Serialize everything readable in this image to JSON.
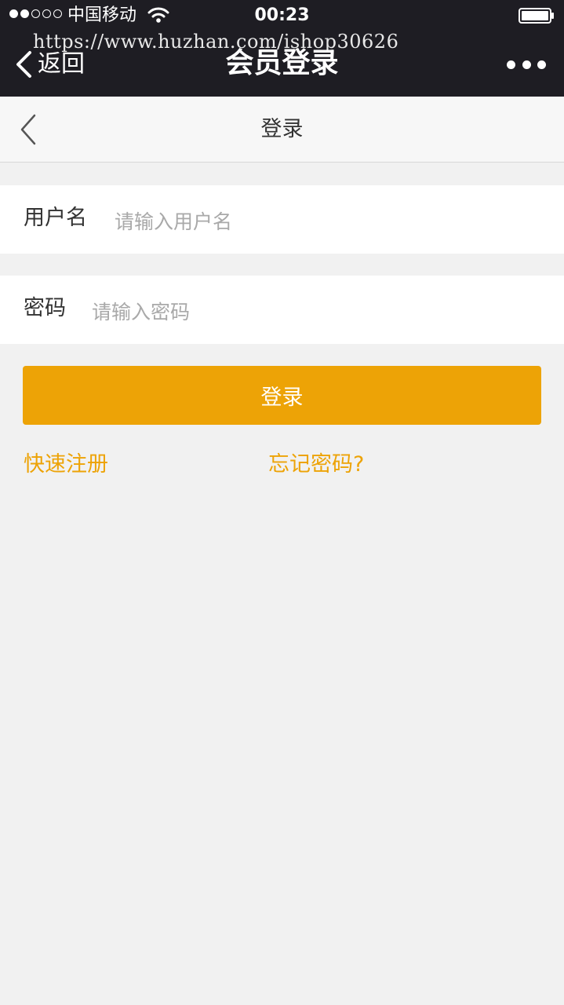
{
  "status_bar": {
    "carrier": "中国移动",
    "time": "00:23"
  },
  "watermark": "https://www.huzhan.com/ishop30626",
  "wechat_nav": {
    "back_label": "返回",
    "title": "会员登录"
  },
  "page_header": {
    "title": "登录"
  },
  "form": {
    "username": {
      "label": "用户名",
      "placeholder": "请输入用户名",
      "value": ""
    },
    "password": {
      "label": "密码",
      "placeholder": "请输入密码",
      "value": ""
    },
    "submit_label": "登录"
  },
  "links": {
    "register": "快速注册",
    "forgot_password": "忘记密码?"
  },
  "colors": {
    "accent": "#eda306",
    "header_dark": "#1e1d23",
    "page_bg": "#f1f1f1"
  }
}
